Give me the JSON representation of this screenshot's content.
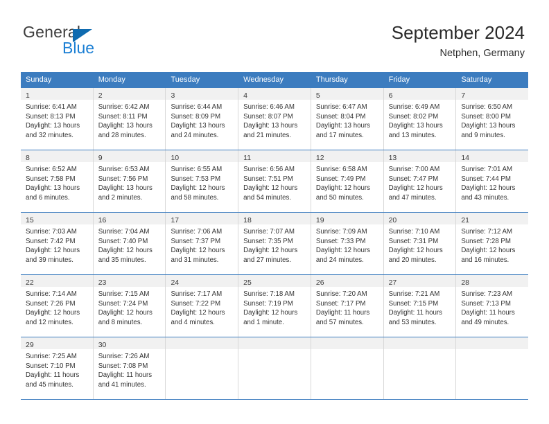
{
  "logo": {
    "word_top": "General",
    "word_bottom": "Blue",
    "triangle_icon": "blue-triangle-icon",
    "colors": {
      "top_text": "#3c3c3c",
      "bottom_text": "#1b7fd4",
      "triangle": "#0f6bb0"
    }
  },
  "header": {
    "title": "September 2024",
    "subtitle": "Netphen, Germany"
  },
  "theme": {
    "header_blue": "#3c7cbf",
    "day_strip_gray": "#f1f1f1",
    "grid_line": "#d8d8d8",
    "text": "#333333"
  },
  "weekdays": [
    "Sunday",
    "Monday",
    "Tuesday",
    "Wednesday",
    "Thursday",
    "Friday",
    "Saturday"
  ],
  "weeks": [
    [
      {
        "day": "1",
        "sunrise": "Sunrise: 6:41 AM",
        "sunset": "Sunset: 8:13 PM",
        "daylight": "Daylight: 13 hours and 32 minutes."
      },
      {
        "day": "2",
        "sunrise": "Sunrise: 6:42 AM",
        "sunset": "Sunset: 8:11 PM",
        "daylight": "Daylight: 13 hours and 28 minutes."
      },
      {
        "day": "3",
        "sunrise": "Sunrise: 6:44 AM",
        "sunset": "Sunset: 8:09 PM",
        "daylight": "Daylight: 13 hours and 24 minutes."
      },
      {
        "day": "4",
        "sunrise": "Sunrise: 6:46 AM",
        "sunset": "Sunset: 8:07 PM",
        "daylight": "Daylight: 13 hours and 21 minutes."
      },
      {
        "day": "5",
        "sunrise": "Sunrise: 6:47 AM",
        "sunset": "Sunset: 8:04 PM",
        "daylight": "Daylight: 13 hours and 17 minutes."
      },
      {
        "day": "6",
        "sunrise": "Sunrise: 6:49 AM",
        "sunset": "Sunset: 8:02 PM",
        "daylight": "Daylight: 13 hours and 13 minutes."
      },
      {
        "day": "7",
        "sunrise": "Sunrise: 6:50 AM",
        "sunset": "Sunset: 8:00 PM",
        "daylight": "Daylight: 13 hours and 9 minutes."
      }
    ],
    [
      {
        "day": "8",
        "sunrise": "Sunrise: 6:52 AM",
        "sunset": "Sunset: 7:58 PM",
        "daylight": "Daylight: 13 hours and 6 minutes."
      },
      {
        "day": "9",
        "sunrise": "Sunrise: 6:53 AM",
        "sunset": "Sunset: 7:56 PM",
        "daylight": "Daylight: 13 hours and 2 minutes."
      },
      {
        "day": "10",
        "sunrise": "Sunrise: 6:55 AM",
        "sunset": "Sunset: 7:53 PM",
        "daylight": "Daylight: 12 hours and 58 minutes."
      },
      {
        "day": "11",
        "sunrise": "Sunrise: 6:56 AM",
        "sunset": "Sunset: 7:51 PM",
        "daylight": "Daylight: 12 hours and 54 minutes."
      },
      {
        "day": "12",
        "sunrise": "Sunrise: 6:58 AM",
        "sunset": "Sunset: 7:49 PM",
        "daylight": "Daylight: 12 hours and 50 minutes."
      },
      {
        "day": "13",
        "sunrise": "Sunrise: 7:00 AM",
        "sunset": "Sunset: 7:47 PM",
        "daylight": "Daylight: 12 hours and 47 minutes."
      },
      {
        "day": "14",
        "sunrise": "Sunrise: 7:01 AM",
        "sunset": "Sunset: 7:44 PM",
        "daylight": "Daylight: 12 hours and 43 minutes."
      }
    ],
    [
      {
        "day": "15",
        "sunrise": "Sunrise: 7:03 AM",
        "sunset": "Sunset: 7:42 PM",
        "daylight": "Daylight: 12 hours and 39 minutes."
      },
      {
        "day": "16",
        "sunrise": "Sunrise: 7:04 AM",
        "sunset": "Sunset: 7:40 PM",
        "daylight": "Daylight: 12 hours and 35 minutes."
      },
      {
        "day": "17",
        "sunrise": "Sunrise: 7:06 AM",
        "sunset": "Sunset: 7:37 PM",
        "daylight": "Daylight: 12 hours and 31 minutes."
      },
      {
        "day": "18",
        "sunrise": "Sunrise: 7:07 AM",
        "sunset": "Sunset: 7:35 PM",
        "daylight": "Daylight: 12 hours and 27 minutes."
      },
      {
        "day": "19",
        "sunrise": "Sunrise: 7:09 AM",
        "sunset": "Sunset: 7:33 PM",
        "daylight": "Daylight: 12 hours and 24 minutes."
      },
      {
        "day": "20",
        "sunrise": "Sunrise: 7:10 AM",
        "sunset": "Sunset: 7:31 PM",
        "daylight": "Daylight: 12 hours and 20 minutes."
      },
      {
        "day": "21",
        "sunrise": "Sunrise: 7:12 AM",
        "sunset": "Sunset: 7:28 PM",
        "daylight": "Daylight: 12 hours and 16 minutes."
      }
    ],
    [
      {
        "day": "22",
        "sunrise": "Sunrise: 7:14 AM",
        "sunset": "Sunset: 7:26 PM",
        "daylight": "Daylight: 12 hours and 12 minutes."
      },
      {
        "day": "23",
        "sunrise": "Sunrise: 7:15 AM",
        "sunset": "Sunset: 7:24 PM",
        "daylight": "Daylight: 12 hours and 8 minutes."
      },
      {
        "day": "24",
        "sunrise": "Sunrise: 7:17 AM",
        "sunset": "Sunset: 7:22 PM",
        "daylight": "Daylight: 12 hours and 4 minutes."
      },
      {
        "day": "25",
        "sunrise": "Sunrise: 7:18 AM",
        "sunset": "Sunset: 7:19 PM",
        "daylight": "Daylight: 12 hours and 1 minute."
      },
      {
        "day": "26",
        "sunrise": "Sunrise: 7:20 AM",
        "sunset": "Sunset: 7:17 PM",
        "daylight": "Daylight: 11 hours and 57 minutes."
      },
      {
        "day": "27",
        "sunrise": "Sunrise: 7:21 AM",
        "sunset": "Sunset: 7:15 PM",
        "daylight": "Daylight: 11 hours and 53 minutes."
      },
      {
        "day": "28",
        "sunrise": "Sunrise: 7:23 AM",
        "sunset": "Sunset: 7:13 PM",
        "daylight": "Daylight: 11 hours and 49 minutes."
      }
    ],
    [
      {
        "day": "29",
        "sunrise": "Sunrise: 7:25 AM",
        "sunset": "Sunset: 7:10 PM",
        "daylight": "Daylight: 11 hours and 45 minutes."
      },
      {
        "day": "30",
        "sunrise": "Sunrise: 7:26 AM",
        "sunset": "Sunset: 7:08 PM",
        "daylight": "Daylight: 11 hours and 41 minutes."
      },
      {
        "day": "",
        "sunrise": "",
        "sunset": "",
        "daylight": ""
      },
      {
        "day": "",
        "sunrise": "",
        "sunset": "",
        "daylight": ""
      },
      {
        "day": "",
        "sunrise": "",
        "sunset": "",
        "daylight": ""
      },
      {
        "day": "",
        "sunrise": "",
        "sunset": "",
        "daylight": ""
      },
      {
        "day": "",
        "sunrise": "",
        "sunset": "",
        "daylight": ""
      }
    ]
  ]
}
